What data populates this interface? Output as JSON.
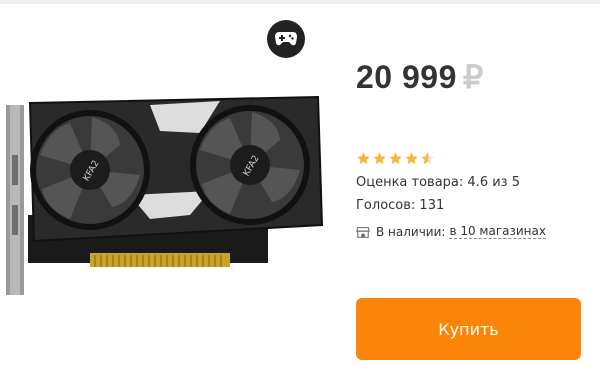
{
  "product": {
    "image_icon": "graphics-card-image",
    "badge_icon": "gamepad-icon",
    "price_value": "20 999",
    "price_currency": "₽",
    "rating_value": 4.6,
    "rating_max": 5,
    "rating_text": "Оценка товара: 4.6 из 5",
    "votes_text": "Голосов: 131",
    "availability_label": "В наличии:",
    "availability_link": "в 10 магазинах",
    "availability_icon": "store-icon",
    "buy_label": "Купить"
  },
  "colors": {
    "accent": "#fc8507",
    "star": "#fcb53b",
    "text": "#333333",
    "currency": "#cccccc"
  }
}
